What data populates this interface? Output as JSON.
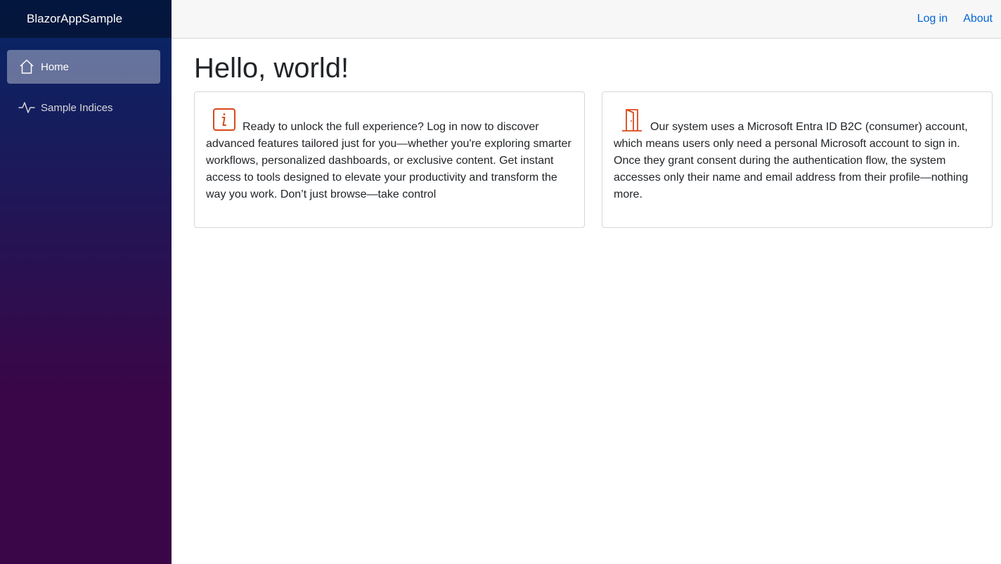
{
  "app": {
    "brand": "BlazorAppSample"
  },
  "sidebar": {
    "items": [
      {
        "label": "Home",
        "icon": "home-icon",
        "active": true
      },
      {
        "label": "Sample Indices",
        "icon": "activity-icon",
        "active": false
      }
    ]
  },
  "topbar": {
    "login_label": "Log in",
    "about_label": "About"
  },
  "main": {
    "title": "Hello, world!",
    "cards": [
      {
        "icon": "info-icon",
        "text": "Ready to unlock the full experience? Log in now to discover advanced features tailored just for you—whether you're exploring smarter workflows, personalized dashboards, or exclusive content. Get instant access to tools designed to elevate your productivity and transform the way you work. Don’t just browse—take control"
      },
      {
        "icon": "door-icon",
        "text": "Our system uses a Microsoft Entra ID B2C (consumer) account, which means users only need a personal Microsoft account to sign in. Once they grant consent during the authentication flow, the system accesses only their name and email address from their profile—nothing more."
      }
    ]
  },
  "colors": {
    "sidebar_gradient_top": "#052767",
    "sidebar_gradient_bottom": "#3a0647",
    "link": "#0366d6",
    "icon_accent": "#d9481c"
  }
}
